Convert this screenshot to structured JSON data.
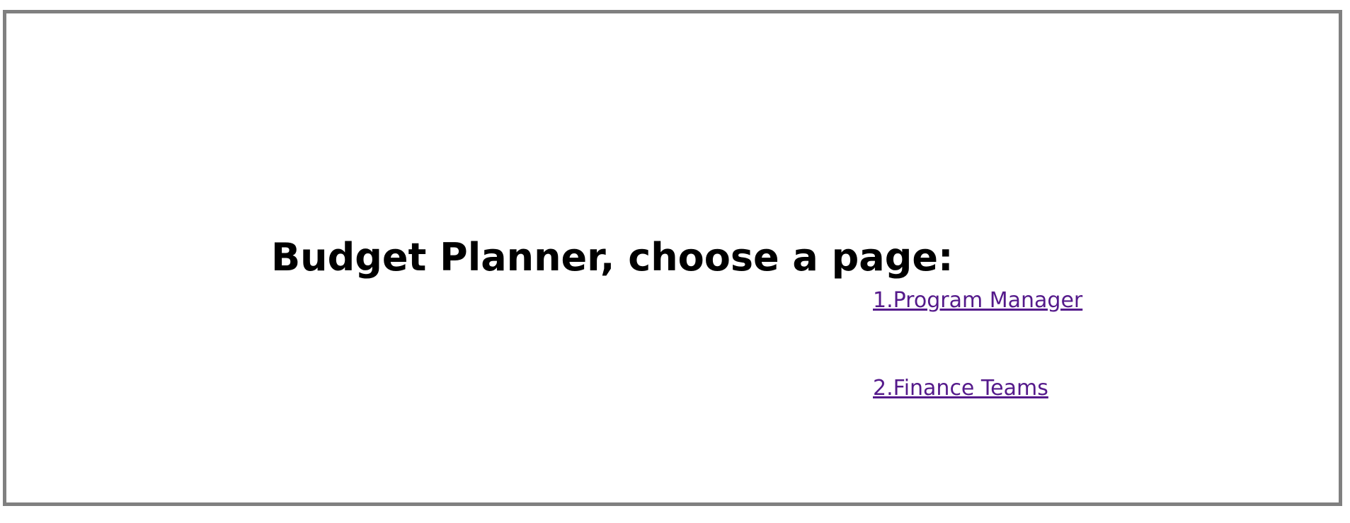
{
  "page": {
    "heading": "Budget Planner, choose a page:",
    "links": [
      {
        "label": "1.Program Manager"
      },
      {
        "label": "2.Finance Teams"
      }
    ]
  },
  "colors": {
    "visited_link": "#551A8B",
    "frame_border": "#808080",
    "background": "#ffffff",
    "text": "#000000"
  }
}
